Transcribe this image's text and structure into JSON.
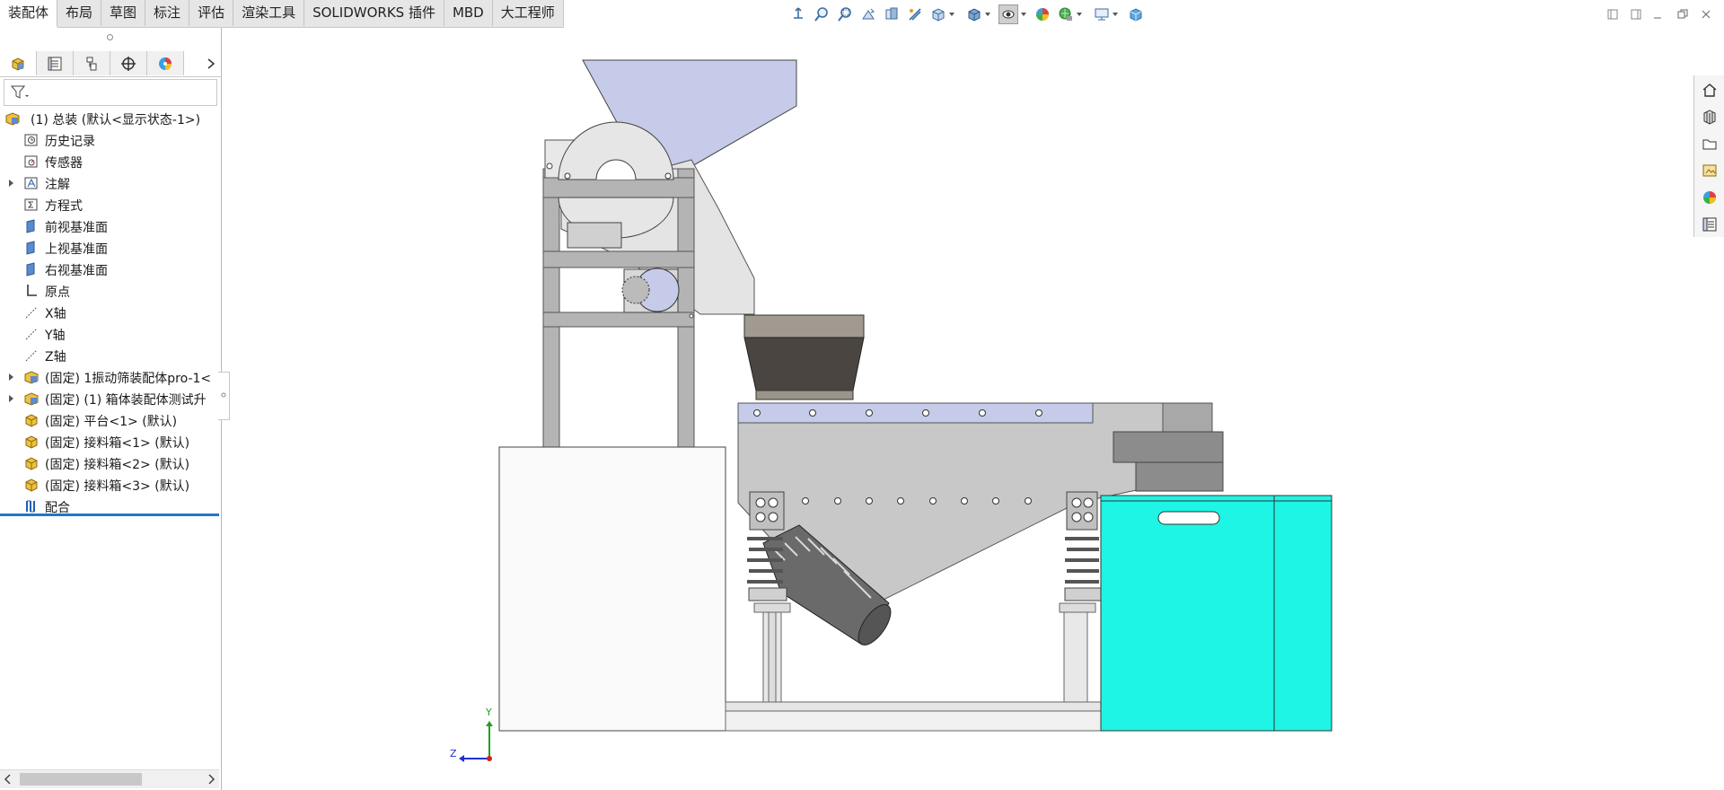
{
  "tabs": [
    "装配体",
    "布局",
    "草图",
    "标注",
    "评估",
    "渲染工具",
    "SOLIDWORKS 插件",
    "MBD",
    "大工程师"
  ],
  "active_tab": "装配体",
  "hud_icons": [
    "view-orientation-icon",
    "zoom-to-fit-icon",
    "zoom-to-area-icon",
    "previous-view-icon",
    "section-view-icon",
    "dynamic-annotation-icon",
    "view-settings-icon",
    "display-style-icon",
    "hide-show-items-icon",
    "edit-appearance-icon",
    "apply-scene-icon",
    "view-setting-display-icon",
    "3d-view-icon"
  ],
  "manager_tabs": [
    "feature-manager-icon",
    "property-manager-icon",
    "configuration-manager-icon",
    "dimxpert-manager-icon",
    "display-manager-icon"
  ],
  "tree": {
    "root": "(1) 总装 (默认<显示状态-1>)",
    "items": [
      {
        "label": "历史记录",
        "icon": "history-icon",
        "expandable": false
      },
      {
        "label": "传感器",
        "icon": "sensor-icon",
        "expandable": false
      },
      {
        "label": "注解",
        "icon": "annotation-icon",
        "expandable": true
      },
      {
        "label": "方程式",
        "icon": "equation-icon",
        "expandable": false
      },
      {
        "label": "前视基准面",
        "icon": "plane-icon",
        "expandable": false
      },
      {
        "label": "上视基准面",
        "icon": "plane-icon",
        "expandable": false
      },
      {
        "label": "右视基准面",
        "icon": "plane-icon",
        "expandable": false
      },
      {
        "label": "原点",
        "icon": "origin-icon",
        "expandable": false
      },
      {
        "label": "X轴",
        "icon": "axis-icon",
        "expandable": false
      },
      {
        "label": "Y轴",
        "icon": "axis-icon",
        "expandable": false
      },
      {
        "label": "Z轴",
        "icon": "axis-icon",
        "expandable": false
      },
      {
        "label": "(固定) 1振动筛装配体pro-1<",
        "icon": "subassembly-icon",
        "expandable": true
      },
      {
        "label": "(固定) (1) 箱体装配体测试升",
        "icon": "subassembly-icon",
        "expandable": true
      },
      {
        "label": "(固定) 平台<1> (默认)",
        "icon": "part-icon",
        "expandable": false
      },
      {
        "label": "(固定) 接料箱<1> (默认)",
        "icon": "part-icon",
        "expandable": false
      },
      {
        "label": "(固定) 接料箱<2> (默认)",
        "icon": "part-icon",
        "expandable": false
      },
      {
        "label": "(固定) 接料箱<3> (默认)",
        "icon": "part-icon",
        "expandable": false
      },
      {
        "label": "配合",
        "icon": "mates-icon",
        "expandable": false
      }
    ]
  },
  "triad": {
    "y": "Y",
    "z": "Z"
  },
  "task_pane": [
    "home-icon",
    "design-library-icon",
    "file-explorer-icon",
    "view-palette-icon",
    "appearances-icon",
    "custom-properties-icon"
  ],
  "colors": {
    "hopper": "#c5cbe8",
    "bin": "#1ef5e4",
    "frame": "#b4b4b4",
    "body": "#c8c8c8",
    "accent": "#1e78c8"
  }
}
